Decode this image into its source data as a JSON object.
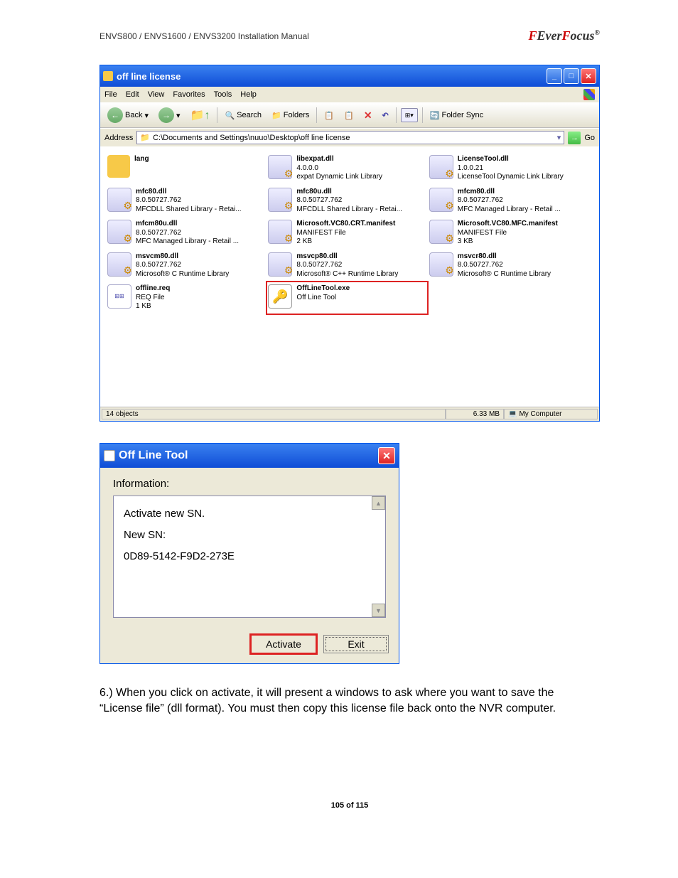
{
  "header": {
    "left": "ENVS800 / ENVS1600 / ENVS3200 Installation Manual",
    "brand_pre": "Ever",
    "brand_f": "F",
    "brand_post": "ocus"
  },
  "explorer": {
    "title": "off line license",
    "menu": [
      "File",
      "Edit",
      "View",
      "Favorites",
      "Tools",
      "Help"
    ],
    "toolbar": {
      "back": "Back",
      "search": "Search",
      "folders": "Folders",
      "sync": "Folder Sync"
    },
    "address_label": "Address",
    "address": "C:\\Documents and Settings\\nuuo\\Desktop\\off line license",
    "go": "Go",
    "items": [
      {
        "name": "lang",
        "l2": "",
        "l3": "",
        "type": "folder"
      },
      {
        "name": "libexpat.dll",
        "l2": "4.0.0.0",
        "l3": "expat Dynamic Link Library",
        "type": "dll"
      },
      {
        "name": "LicenseTool.dll",
        "l2": "1.0.0.21",
        "l3": "LicenseTool Dynamic Link Library",
        "type": "dll"
      },
      {
        "name": "mfc80.dll",
        "l2": "8.0.50727.762",
        "l3": "MFCDLL Shared Library - Retai...",
        "type": "dll"
      },
      {
        "name": "mfc80u.dll",
        "l2": "8.0.50727.762",
        "l3": "MFCDLL Shared Library - Retai...",
        "type": "dll"
      },
      {
        "name": "mfcm80.dll",
        "l2": "8.0.50727.762",
        "l3": "MFC Managed Library - Retail ...",
        "type": "dll"
      },
      {
        "name": "mfcm80u.dll",
        "l2": "8.0.50727.762",
        "l3": "MFC Managed Library - Retail ...",
        "type": "dll"
      },
      {
        "name": "Microsoft.VC80.CRT.manifest",
        "l2": "MANIFEST File",
        "l3": "2 KB",
        "type": "dll"
      },
      {
        "name": "Microsoft.VC80.MFC.manifest",
        "l2": "MANIFEST File",
        "l3": "3 KB",
        "type": "dll"
      },
      {
        "name": "msvcm80.dll",
        "l2": "8.0.50727.762",
        "l3": "Microsoft® C Runtime Library",
        "type": "dll"
      },
      {
        "name": "msvcp80.dll",
        "l2": "8.0.50727.762",
        "l3": "Microsoft® C++ Runtime Library",
        "type": "dll"
      },
      {
        "name": "msvcr80.dll",
        "l2": "8.0.50727.762",
        "l3": "Microsoft® C Runtime Library",
        "type": "dll"
      },
      {
        "name": "offline.req",
        "l2": "REQ File",
        "l3": "1 KB",
        "type": "req"
      },
      {
        "name": "OffLineTool.exe",
        "l2": "Off Line Tool",
        "l3": "",
        "type": "exe",
        "highlight": true
      }
    ],
    "status": {
      "objects": "14 objects",
      "size": "6.33 MB",
      "location": "My Computer"
    }
  },
  "dialog": {
    "title": "Off Line Tool",
    "info_label": "Information:",
    "line1": "Activate new SN.",
    "line2": "New SN:",
    "line3": "0D89-5142-F9D2-273E",
    "activate": "Activate",
    "exit": "Exit"
  },
  "step6": "6.)  When you click on activate, it will present a windows to ask where you want to save the “License file” (dll format). You must then copy this license file back onto the NVR computer.",
  "pagenum": "105 of 115"
}
